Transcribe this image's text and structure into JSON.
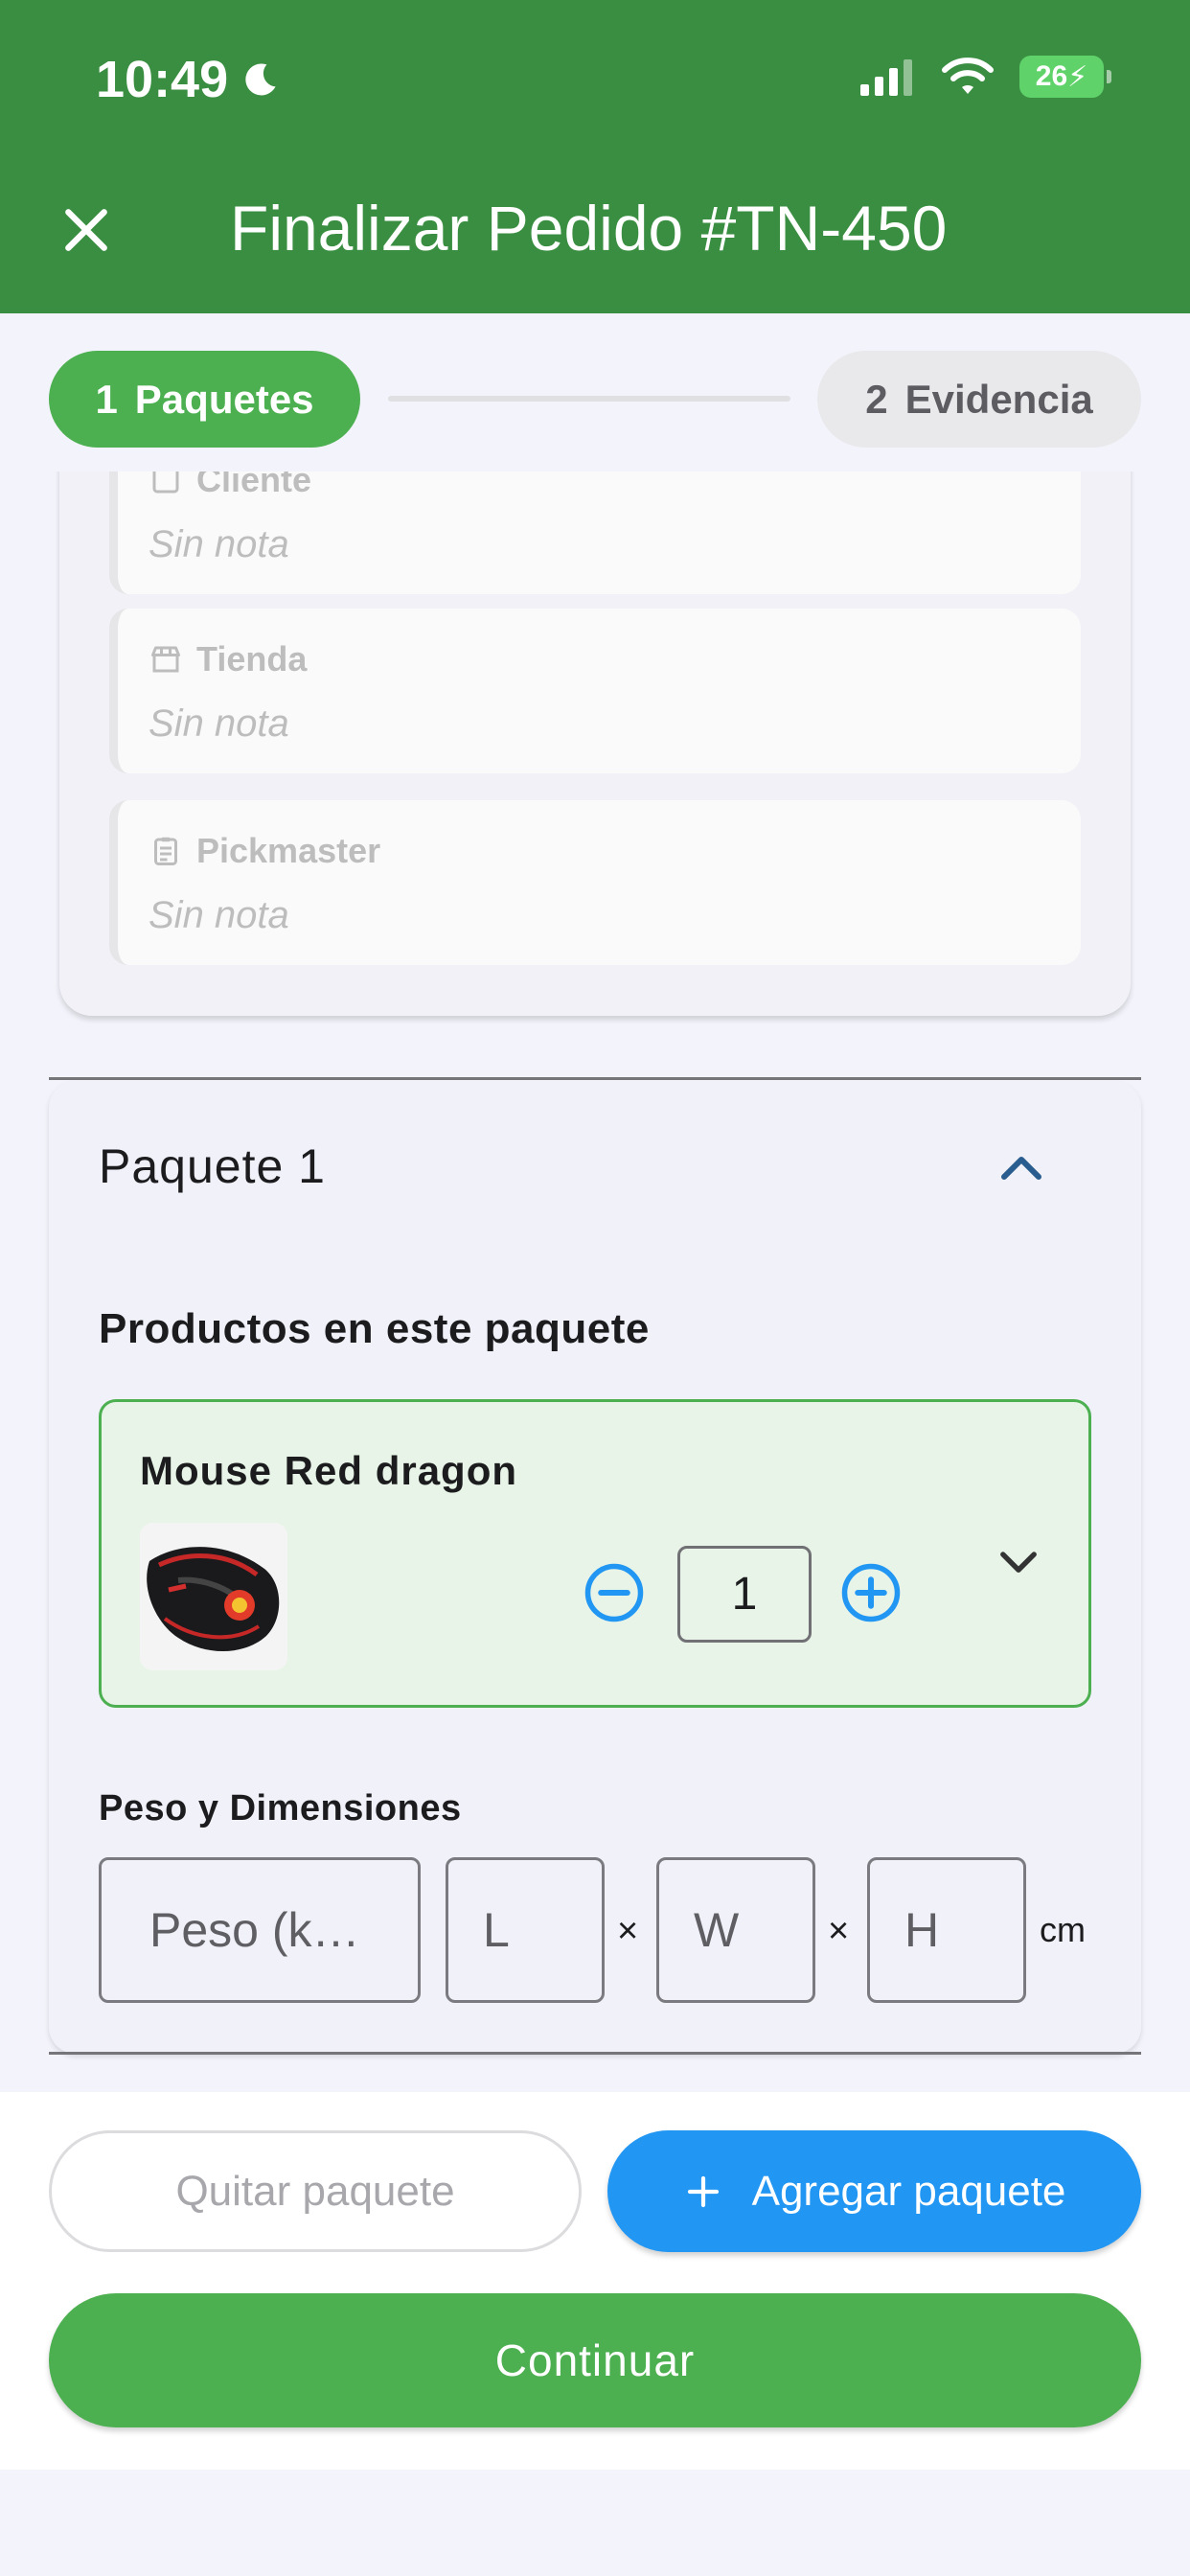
{
  "status_bar": {
    "time": "10:49",
    "battery": "26"
  },
  "header": {
    "title": "Finalizar Pedido #TN-450"
  },
  "stepper": {
    "steps": [
      {
        "number": "1",
        "label": "Paquetes"
      },
      {
        "number": "2",
        "label": "Evidencia"
      }
    ]
  },
  "notes": [
    {
      "label": "Cliente",
      "text": "Sin nota"
    },
    {
      "label": "Tienda",
      "text": "Sin nota"
    },
    {
      "label": "Pickmaster",
      "text": "Sin nota"
    }
  ],
  "package": {
    "title": "Paquete 1",
    "products_title": "Productos en este paquete",
    "product": {
      "name": "Mouse Red dragon",
      "quantity": "1"
    },
    "dimensions_title": "Peso y Dimensiones",
    "fields": {
      "peso": "Peso (k…",
      "l": "L",
      "w": "W",
      "h": "H"
    },
    "times_symbol": "×",
    "unit": "cm"
  },
  "footer": {
    "remove_label": "Quitar paquete",
    "add_label": "Agregar paquete",
    "continue_label": "Continuar"
  },
  "colors": {
    "header_green": "#3a8e41",
    "primary_green": "#4caf50",
    "blue": "#2196f3",
    "product_bg": "#e7f4e7"
  }
}
